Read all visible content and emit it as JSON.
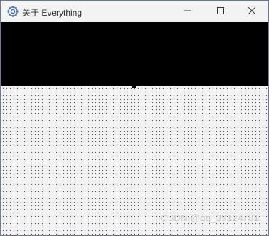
{
  "window": {
    "title": "关于 Everything",
    "app_icon": "everything-gear-icon",
    "controls": {
      "minimize_icon": "minimize-icon",
      "maximize_icon": "maximize-icon",
      "close_icon": "close-icon"
    }
  },
  "content": {
    "top_panel_color": "#000000",
    "dotted_area_color": "#f2f2f2"
  },
  "watermark": {
    "text": "CSDN @qq_39124701"
  }
}
